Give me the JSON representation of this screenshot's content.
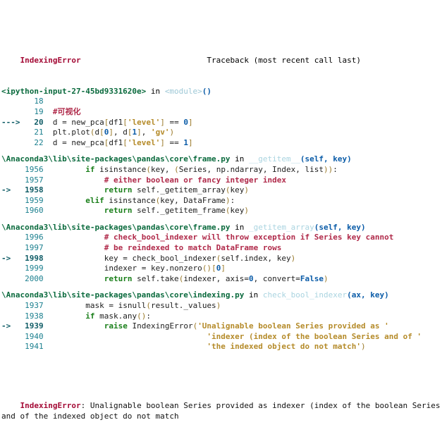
{
  "header": {
    "exception_name": "IndexingError",
    "traceback_label": "Traceback (most recent call last)"
  },
  "frames": [
    {
      "location_prefix": "<ipython-input-27-45bd9331620e>",
      "in_word": " in ",
      "function_name": "<module>",
      "function_args": "()",
      "is_ipython_cell": true,
      "lines": [
        {
          "arrow": "",
          "number": "18",
          "current": false,
          "segments": []
        },
        {
          "arrow": "",
          "number": "19",
          "current": false,
          "segments": [
            {
              "t": "#可视化",
              "c": "comment"
            }
          ]
        },
        {
          "arrow": "--->",
          "number": "20",
          "current": true,
          "segments": [
            {
              "t": "d ",
              "c": "code"
            },
            {
              "t": "=",
              "c": "code"
            },
            {
              "t": " new_pca",
              "c": "code"
            },
            {
              "t": "[",
              "c": "punct-par"
            },
            {
              "t": "df1",
              "c": "code"
            },
            {
              "t": "[",
              "c": "punct-par"
            },
            {
              "t": "'level'",
              "c": "str"
            },
            {
              "t": "]",
              "c": "punct-par"
            },
            {
              "t": " ",
              "c": "code"
            },
            {
              "t": "==",
              "c": "code"
            },
            {
              "t": " ",
              "c": "code"
            },
            {
              "t": "0",
              "c": "num"
            },
            {
              "t": "]",
              "c": "punct-par"
            }
          ]
        },
        {
          "arrow": "",
          "number": "21",
          "current": false,
          "segments": [
            {
              "t": "plt.plot",
              "c": "code"
            },
            {
              "t": "(",
              "c": "punct-par"
            },
            {
              "t": "d",
              "c": "code"
            },
            {
              "t": "[",
              "c": "punct-par"
            },
            {
              "t": "0",
              "c": "num"
            },
            {
              "t": "]",
              "c": "punct-par"
            },
            {
              "t": ", d",
              "c": "code"
            },
            {
              "t": "[",
              "c": "punct-par"
            },
            {
              "t": "1",
              "c": "num"
            },
            {
              "t": "]",
              "c": "punct-par"
            },
            {
              "t": ", ",
              "c": "code"
            },
            {
              "t": "'gv'",
              "c": "str"
            },
            {
              "t": ")",
              "c": "punct-par"
            }
          ]
        },
        {
          "arrow": "",
          "number": "22",
          "current": false,
          "segments": [
            {
              "t": "d ",
              "c": "code"
            },
            {
              "t": "=",
              "c": "code"
            },
            {
              "t": " new_pca",
              "c": "code"
            },
            {
              "t": "[",
              "c": "punct-par"
            },
            {
              "t": "df1",
              "c": "code"
            },
            {
              "t": "[",
              "c": "punct-par"
            },
            {
              "t": "'level'",
              "c": "str"
            },
            {
              "t": "]",
              "c": "punct-par"
            },
            {
              "t": " ",
              "c": "code"
            },
            {
              "t": "==",
              "c": "code"
            },
            {
              "t": " ",
              "c": "code"
            },
            {
              "t": "1",
              "c": "num"
            },
            {
              "t": "]",
              "c": "punct-par"
            }
          ]
        }
      ]
    },
    {
      "location_prefix": "\\Anaconda3\\lib\\site-packages\\pandas\\core\\frame.py",
      "in_word": " in ",
      "function_name": "__getitem__",
      "function_args": "(self, key)",
      "is_ipython_cell": false,
      "lines": [
        {
          "arrow": "",
          "number": "1956",
          "current": false,
          "indent": 8,
          "segments": [
            {
              "t": "if ",
              "c": "kw"
            },
            {
              "t": "isinstance",
              "c": "code"
            },
            {
              "t": "(",
              "c": "punct-par"
            },
            {
              "t": "key, ",
              "c": "code"
            },
            {
              "t": "(",
              "c": "punct-par"
            },
            {
              "t": "Series, np.ndarray, Index, ",
              "c": "code"
            },
            {
              "t": "list",
              "c": "code"
            },
            {
              "t": "))",
              "c": "punct-par"
            },
            {
              "t": ":",
              "c": "code"
            }
          ]
        },
        {
          "arrow": "",
          "number": "1957",
          "current": false,
          "indent": 12,
          "segments": [
            {
              "t": "# either boolean or fancy integer index",
              "c": "comment"
            }
          ]
        },
        {
          "arrow": "->",
          "number": "1958",
          "current": true,
          "indent": 12,
          "segments": [
            {
              "t": "return ",
              "c": "kw"
            },
            {
              "t": "self._getitem_array",
              "c": "code"
            },
            {
              "t": "(",
              "c": "punct-par"
            },
            {
              "t": "key",
              "c": "code"
            },
            {
              "t": ")",
              "c": "punct-par"
            }
          ]
        },
        {
          "arrow": "",
          "number": "1959",
          "current": false,
          "indent": 8,
          "segments": [
            {
              "t": "elif ",
              "c": "kw"
            },
            {
              "t": "isinstance",
              "c": "code"
            },
            {
              "t": "(",
              "c": "punct-par"
            },
            {
              "t": "key, DataFrame",
              "c": "code"
            },
            {
              "t": ")",
              "c": "punct-par"
            },
            {
              "t": ":",
              "c": "code"
            }
          ]
        },
        {
          "arrow": "",
          "number": "1960",
          "current": false,
          "indent": 12,
          "segments": [
            {
              "t": "return ",
              "c": "kw"
            },
            {
              "t": "self._getitem_frame",
              "c": "code"
            },
            {
              "t": "(",
              "c": "punct-par"
            },
            {
              "t": "key",
              "c": "code"
            },
            {
              "t": ")",
              "c": "punct-par"
            }
          ]
        }
      ]
    },
    {
      "location_prefix": "\\Anaconda3\\lib\\site-packages\\pandas\\core\\frame.py",
      "in_word": " in ",
      "function_name": "_getitem_array",
      "function_args": "(self, key)",
      "is_ipython_cell": false,
      "lines": [
        {
          "arrow": "",
          "number": "1996",
          "current": false,
          "indent": 12,
          "segments": [
            {
              "t": "# check_bool_indexer will throw exception if Series key cannot",
              "c": "comment"
            }
          ]
        },
        {
          "arrow": "",
          "number": "1997",
          "current": false,
          "indent": 12,
          "segments": [
            {
              "t": "# be reindexed to match DataFrame rows",
              "c": "comment"
            }
          ]
        },
        {
          "arrow": "->",
          "number": "1998",
          "current": true,
          "indent": 12,
          "segments": [
            {
              "t": "key ",
              "c": "code"
            },
            {
              "t": "=",
              "c": "code"
            },
            {
              "t": " check_bool_indexer",
              "c": "code"
            },
            {
              "t": "(",
              "c": "punct-par"
            },
            {
              "t": "self.index, key",
              "c": "code"
            },
            {
              "t": ")",
              "c": "punct-par"
            }
          ]
        },
        {
          "arrow": "",
          "number": "1999",
          "current": false,
          "indent": 12,
          "segments": [
            {
              "t": "indexer ",
              "c": "code"
            },
            {
              "t": "=",
              "c": "code"
            },
            {
              "t": " key.nonzero",
              "c": "code"
            },
            {
              "t": "()",
              "c": "punct-par"
            },
            {
              "t": "[",
              "c": "punct-par"
            },
            {
              "t": "0",
              "c": "num"
            },
            {
              "t": "]",
              "c": "punct-par"
            }
          ]
        },
        {
          "arrow": "",
          "number": "2000",
          "current": false,
          "indent": 12,
          "segments": [
            {
              "t": "return ",
              "c": "kw"
            },
            {
              "t": "self.take",
              "c": "code"
            },
            {
              "t": "(",
              "c": "punct-par"
            },
            {
              "t": "indexer, axis",
              "c": "code"
            },
            {
              "t": "=",
              "c": "code"
            },
            {
              "t": "0",
              "c": "num"
            },
            {
              "t": ", convert",
              "c": "code"
            },
            {
              "t": "=",
              "c": "code"
            },
            {
              "t": "False",
              "c": "bool-lit"
            },
            {
              "t": ")",
              "c": "punct-par"
            }
          ]
        }
      ]
    },
    {
      "location_prefix": "\\Anaconda3\\lib\\site-packages\\pandas\\core\\indexing.py",
      "in_word": " in ",
      "function_name": "check_bool_indexer",
      "function_args": "(ax, key)",
      "is_ipython_cell": false,
      "lines": [
        {
          "arrow": "",
          "number": "1937",
          "current": false,
          "indent": 8,
          "segments": [
            {
              "t": "mask ",
              "c": "code"
            },
            {
              "t": "=",
              "c": "code"
            },
            {
              "t": " isnull",
              "c": "code"
            },
            {
              "t": "(",
              "c": "punct-par"
            },
            {
              "t": "result._values",
              "c": "code"
            },
            {
              "t": ")",
              "c": "punct-par"
            }
          ]
        },
        {
          "arrow": "",
          "number": "1938",
          "current": false,
          "indent": 8,
          "segments": [
            {
              "t": "if ",
              "c": "kw"
            },
            {
              "t": "mask.any",
              "c": "code"
            },
            {
              "t": "()",
              "c": "punct-par"
            },
            {
              "t": ":",
              "c": "code"
            }
          ]
        },
        {
          "arrow": "->",
          "number": "1939",
          "current": true,
          "indent": 12,
          "segments": [
            {
              "t": "raise ",
              "c": "kw"
            },
            {
              "t": "IndexingError",
              "c": "code"
            },
            {
              "t": "(",
              "c": "punct-par"
            },
            {
              "t": "'Unalignable boolean Series provided as '",
              "c": "str"
            }
          ]
        },
        {
          "arrow": "",
          "number": "1940",
          "current": false,
          "indent": 34,
          "segments": [
            {
              "t": "'indexer (index of the boolean Series and of '",
              "c": "str"
            }
          ]
        },
        {
          "arrow": "",
          "number": "1941",
          "current": false,
          "indent": 34,
          "segments": [
            {
              "t": "'the indexed object do not match'",
              "c": "str"
            },
            {
              "t": ")",
              "c": "punct-par"
            }
          ]
        }
      ]
    }
  ],
  "final": {
    "exception_name": "IndexingError",
    "separator": ": ",
    "message": "Unalignable boolean Series provided as indexer (index of the boolean Series and of the indexed object do not match"
  }
}
